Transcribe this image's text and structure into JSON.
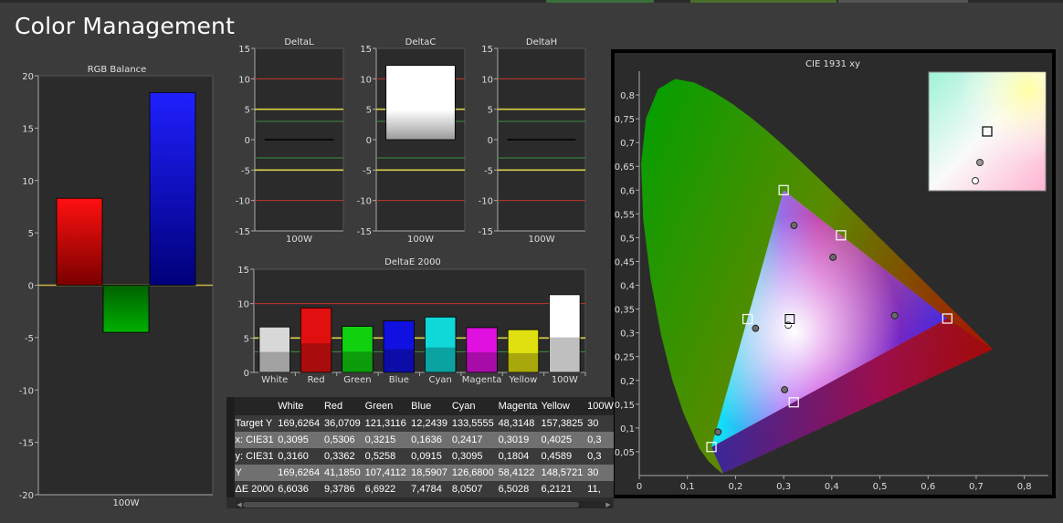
{
  "page": {
    "title": "Color Management"
  },
  "colors": {
    "background": "#3b3b3b",
    "plot_background": "#2b2b2b",
    "red_line": "#c0392b",
    "yellow_line": "#d9d24a",
    "green_line": "#3c8f3c",
    "cie_frame": "#000000"
  },
  "chart_data": [
    {
      "id": "rgb_balance",
      "type": "bar",
      "title": "RGB Balance",
      "categories": [
        "100W"
      ],
      "series": [
        {
          "color": "#ff0000",
          "values": [
            8.3
          ]
        },
        {
          "color": "#00a000",
          "values": [
            -4.5
          ]
        },
        {
          "color": "#0000ff",
          "values": [
            18.4
          ]
        }
      ],
      "ylim": [
        -20,
        20
      ],
      "yticks": [
        -20,
        -15,
        -10,
        -5,
        0,
        5,
        10,
        15,
        20
      ],
      "reference_lines": [
        {
          "value": 0,
          "color": "#c9b34a"
        }
      ]
    },
    {
      "id": "delta_l",
      "type": "bar",
      "title": "DeltaL",
      "categories": [
        "100W"
      ],
      "values": [
        0.1
      ],
      "ylim": [
        -15,
        15
      ],
      "yticks": [
        -15,
        -10,
        -5,
        0,
        5,
        10,
        15
      ],
      "reference_lines": [
        {
          "value": 10,
          "color": "#c0392b"
        },
        {
          "value": 5,
          "color": "#d9d24a"
        },
        {
          "value": 3,
          "color": "#3c8f3c"
        },
        {
          "value": -3,
          "color": "#3c8f3c"
        },
        {
          "value": -5,
          "color": "#d9d24a"
        },
        {
          "value": -10,
          "color": "#c0392b"
        }
      ]
    },
    {
      "id": "delta_c",
      "type": "bar",
      "title": "DeltaC",
      "categories": [
        "100W"
      ],
      "values": [
        12.2
      ],
      "ylim": [
        -15,
        15
      ],
      "yticks": [
        -15,
        -10,
        -5,
        0,
        5,
        10,
        15
      ],
      "reference_lines": [
        {
          "value": 10,
          "color": "#c0392b"
        },
        {
          "value": 5,
          "color": "#d9d24a"
        },
        {
          "value": 3,
          "color": "#3c8f3c"
        },
        {
          "value": -3,
          "color": "#3c8f3c"
        },
        {
          "value": -5,
          "color": "#d9d24a"
        },
        {
          "value": -10,
          "color": "#c0392b"
        }
      ]
    },
    {
      "id": "delta_h",
      "type": "bar",
      "title": "DeltaH",
      "categories": [
        "100W"
      ],
      "values": [
        0.1
      ],
      "ylim": [
        -15,
        15
      ],
      "yticks": [
        -15,
        -10,
        -5,
        0,
        5,
        10,
        15
      ],
      "reference_lines": [
        {
          "value": 10,
          "color": "#c0392b"
        },
        {
          "value": 5,
          "color": "#d9d24a"
        },
        {
          "value": 3,
          "color": "#3c8f3c"
        },
        {
          "value": -3,
          "color": "#3c8f3c"
        },
        {
          "value": -5,
          "color": "#d9d24a"
        },
        {
          "value": -10,
          "color": "#c0392b"
        }
      ]
    },
    {
      "id": "delta_e_2000",
      "type": "bar",
      "title": "DeltaE 2000",
      "categories": [
        "White",
        "Red",
        "Green",
        "Blue",
        "Cyan",
        "Magenta",
        "Yellow",
        "100W"
      ],
      "values": [
        6.6036,
        9.3786,
        6.6922,
        7.4784,
        8.0507,
        6.5028,
        6.2121,
        11.3
      ],
      "bar_colors": [
        "#d8d8d8",
        "#e01010",
        "#10d010",
        "#1010e0",
        "#10d8d8",
        "#e010e0",
        "#e0e010",
        "#ffffff"
      ],
      "ylim": [
        0,
        15
      ],
      "yticks": [
        0,
        5,
        10,
        15
      ],
      "reference_lines": [
        {
          "value": 10,
          "color": "#c0392b"
        },
        {
          "value": 5,
          "color": "#d9d24a"
        },
        {
          "value": 3,
          "color": "#3c8f3c"
        }
      ]
    },
    {
      "id": "cie_1931_xy",
      "type": "scatter",
      "title": "CIE 1931 xy",
      "xlim": [
        0,
        0.85
      ],
      "ylim": [
        0,
        0.85
      ],
      "xticks": [
        "0",
        "0,1",
        "0,2",
        "0,3",
        "0,4",
        "0,5",
        "0,6",
        "0,7",
        "0,8"
      ],
      "yticks": [
        "0,05",
        "0,1",
        "0,15",
        "0,2",
        "0,25",
        "0,3",
        "0,35",
        "0,4",
        "0,45",
        "0,5",
        "0,55",
        "0,6",
        "0,65",
        "0,7",
        "0,75",
        "0,8"
      ],
      "series": [
        {
          "marker": "square",
          "points": [
            {
              "x": 0.64,
              "y": 0.33
            },
            {
              "x": 0.3,
              "y": 0.6
            },
            {
              "x": 0.15,
              "y": 0.06
            },
            {
              "x": 0.225,
              "y": 0.329
            },
            {
              "x": 0.321,
              "y": 0.154
            },
            {
              "x": 0.419,
              "y": 0.505
            },
            {
              "x": 0.3127,
              "y": 0.329
            }
          ]
        },
        {
          "marker": "circle",
          "points": [
            {
              "x": 0.5306,
              "y": 0.3362
            },
            {
              "x": 0.3215,
              "y": 0.5258
            },
            {
              "x": 0.1636,
              "y": 0.0915
            },
            {
              "x": 0.2417,
              "y": 0.3095
            },
            {
              "x": 0.3019,
              "y": 0.1804
            },
            {
              "x": 0.4025,
              "y": 0.4589
            },
            {
              "x": 0.3095,
              "y": 0.316
            }
          ]
        }
      ],
      "inset": {
        "marker_square": {
          "x": 0.3127,
          "y": 0.329
        },
        "marker_circles": [
          {
            "x": 0.3105,
            "y": 0.3225
          },
          {
            "x": 0.3095,
            "y": 0.316
          }
        ]
      }
    }
  ],
  "table": {
    "headers": [
      "",
      "White",
      "Red",
      "Green",
      "Blue",
      "Cyan",
      "Magenta",
      "Yellow",
      "100W"
    ],
    "rows": [
      [
        "Target Y",
        "169,6264",
        "36,0709",
        "121,3116",
        "12,2439",
        "133,5555",
        "48,3148",
        "157,3825",
        "30"
      ],
      [
        "x: CIE31",
        "0,3095",
        "0,5306",
        "0,3215",
        "0,1636",
        "0,2417",
        "0,3019",
        "0,4025",
        "0,3"
      ],
      [
        "y: CIE31",
        "0,3160",
        "0,3362",
        "0,5258",
        "0,0915",
        "0,3095",
        "0,1804",
        "0,4589",
        "0,3"
      ],
      [
        "Y",
        "169,6264",
        "41,1850",
        "107,4112",
        "18,5907",
        "126,6800",
        "58,4122",
        "148,5721",
        "30"
      ],
      [
        "ΔE 2000",
        "6,6036",
        "9,3786",
        "6,6922",
        "7,4784",
        "8,0507",
        "6,5028",
        "6,2121",
        "11,"
      ]
    ]
  }
}
